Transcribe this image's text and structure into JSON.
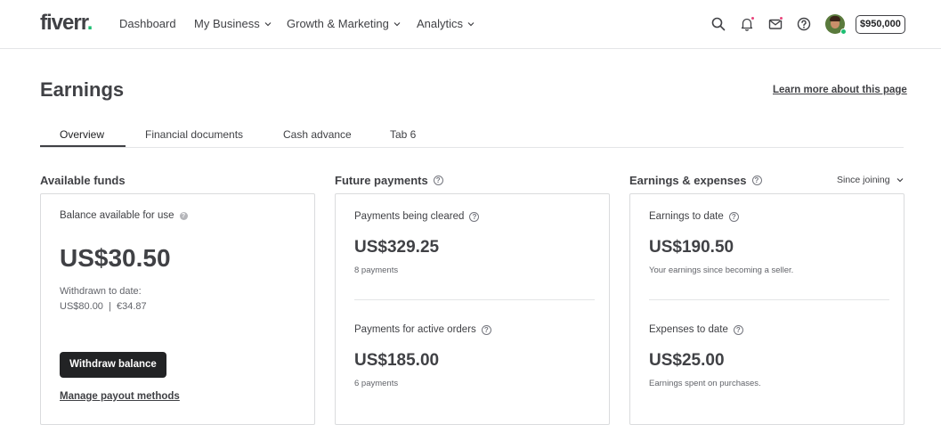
{
  "header": {
    "logo_text": "fiverr",
    "logo_dot": ".",
    "nav": [
      {
        "label": "Dashboard",
        "has_dropdown": false
      },
      {
        "label": "My Business",
        "has_dropdown": true
      },
      {
        "label": "Growth & Marketing",
        "has_dropdown": true
      },
      {
        "label": "Analytics",
        "has_dropdown": true
      }
    ],
    "icons": [
      "search-icon",
      "bell-icon",
      "mail-icon",
      "help-icon"
    ],
    "balance": "$950,000"
  },
  "page": {
    "title": "Earnings",
    "learn_more": "Learn more about this page"
  },
  "tabs": [
    {
      "label": "Overview",
      "active": true
    },
    {
      "label": "Financial documents",
      "active": false
    },
    {
      "label": "Cash advance",
      "active": false
    },
    {
      "label": "Tab 6",
      "active": false
    }
  ],
  "available_funds": {
    "title": "Available funds",
    "balance_label": "Balance available for use",
    "balance": "US$30.50",
    "withdrawn_label": "Withdrawn to date:",
    "withdrawn_value": "US$80.00  |  €34.87",
    "withdraw_button": "Withdraw balance",
    "manage_link": "Manage payout methods"
  },
  "future_payments": {
    "title": "Future payments",
    "cleared_label": "Payments being cleared",
    "cleared_amount": "US$329.25",
    "cleared_count": "8 payments",
    "active_label": "Payments for active orders",
    "active_amount": "US$185.00",
    "active_count": "6 payments"
  },
  "earnings_expenses": {
    "title": "Earnings & expenses",
    "filter": "Since joining",
    "earnings_label": "Earnings to date",
    "earnings_amount": "US$190.50",
    "earnings_desc": "Your earnings since becoming a seller.",
    "expenses_label": "Expenses to date",
    "expenses_amount": "US$25.00",
    "expenses_desc": "Earnings spent on purchases."
  },
  "colors": {
    "brand_green": "#1dbf73",
    "notification_pink": "#e8437a",
    "button_dark": "#222325",
    "text": "#404145"
  }
}
